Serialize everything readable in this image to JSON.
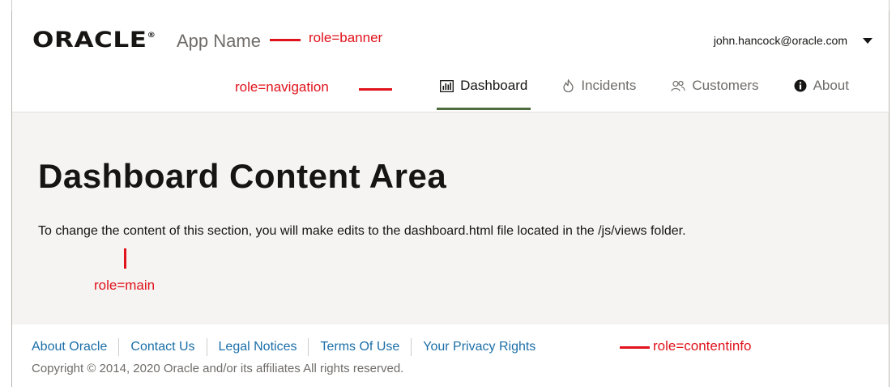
{
  "header": {
    "logo": "ORACLE",
    "logo_mark": "®",
    "app_name": "App Name",
    "user": "john.hancock@oracle.com"
  },
  "nav": [
    {
      "label": "Dashboard",
      "icon": "bar-chart-icon",
      "active": true
    },
    {
      "label": "Incidents",
      "icon": "fire-icon",
      "active": false
    },
    {
      "label": "Customers",
      "icon": "people-icon",
      "active": false
    },
    {
      "label": "About",
      "icon": "info-icon",
      "active": false
    }
  ],
  "main": {
    "title": "Dashboard Content Area",
    "text": "To change the content of this section, you will make edits to the dashboard.html file located in the /js/views folder."
  },
  "footer": {
    "links": [
      "About Oracle",
      "Contact Us",
      "Legal Notices",
      "Terms Of Use",
      "Your Privacy Rights"
    ],
    "copyright": "Copyright © 2014, 2020 Oracle and/or its affiliates All rights reserved."
  },
  "annotations": {
    "banner": "role=banner",
    "navigation": "role=navigation",
    "main": "role=main",
    "contentinfo": "role=contentinfo"
  },
  "colors": {
    "accent": "#4f6c3e",
    "link": "#1b6ea8",
    "annotation": "#e0121b",
    "main_bg": "#f5f4f2"
  }
}
